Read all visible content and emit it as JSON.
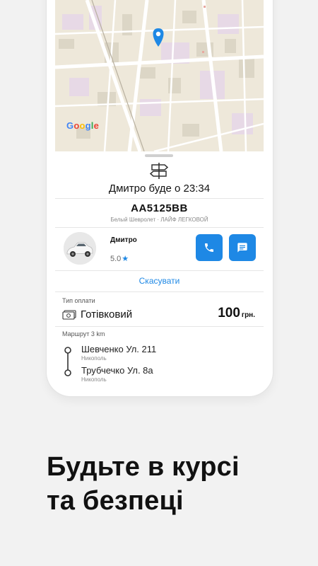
{
  "map": {
    "logo": "Google",
    "pin_color": "#1e88e5"
  },
  "sheet": {
    "eta_text": "Дмитро буде о 23:34",
    "plate": "АА5125ВВ",
    "car_description": "Белый Шевролет · ЛАЙФ ЛЕГКОВОЙ",
    "driver": {
      "name": "Дмитро",
      "rating": "5.0",
      "rating_icon": "star-icon"
    },
    "actions": {
      "call_icon": "phone-icon",
      "message_icon": "message-icon"
    },
    "cancel_label": "Скасувати",
    "payment": {
      "label": "Тип оплати",
      "type": "Готівковий",
      "price": "100",
      "currency": "грн.",
      "icon": "cash-icon"
    },
    "route": {
      "label": "Маршрут 3 km",
      "stops": [
        {
          "name": "Шевченко Ул. 211",
          "city": "Никополь"
        },
        {
          "name": "Трубчечко Ул. 8а",
          "city": "Никополь"
        }
      ]
    }
  },
  "headline": {
    "line1": "Будьте в курсі",
    "line2": "та безпеці"
  },
  "colors": {
    "accent": "#1e88e5",
    "background": "#f2f2f2"
  }
}
